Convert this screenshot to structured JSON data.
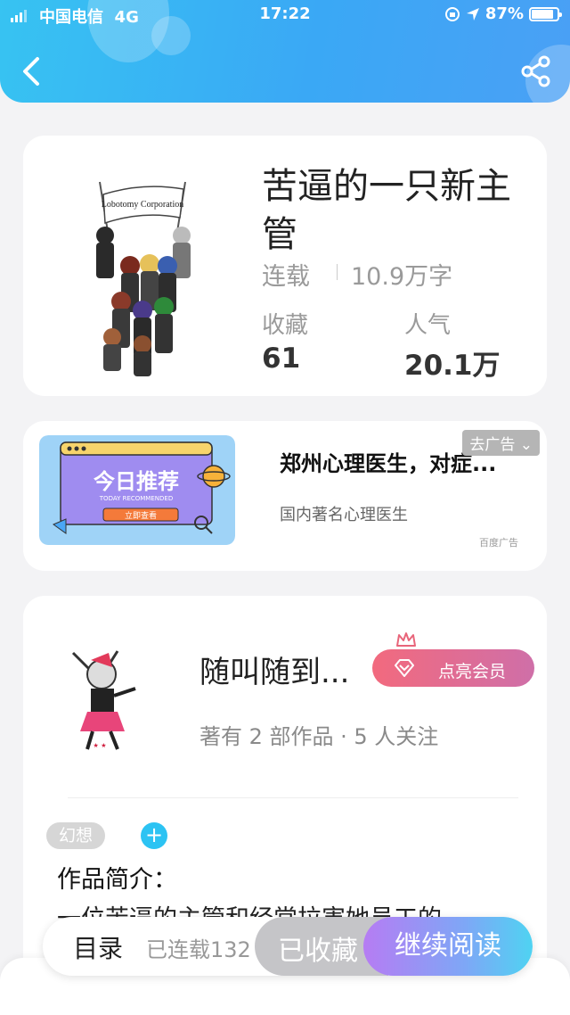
{
  "status_bar": {
    "carrier": "中国电信",
    "network": "4G",
    "time": "17:22",
    "battery": "87%",
    "battery_level": 0.87
  },
  "colors": {
    "header_start": "#37c3f2",
    "header_end": "#4aa0f5",
    "member_start": "#f26a7e",
    "member_end": "#cf6fa8",
    "accent": "#2cc3f3"
  },
  "header": {
    "back_icon": "chevron-left-icon",
    "share_icon": "share-icon"
  },
  "book": {
    "cover_text": "Lobotomy Corporation",
    "title": "苦逼的一只新主管",
    "status": "连载",
    "word_count": "10.9万字",
    "favorites_label": "收藏",
    "favorites": "61",
    "popularity_label": "人气",
    "popularity": "20.1万"
  },
  "ad": {
    "image_title": "今日推荐",
    "image_subtitle": "TODAY RECOMMENDED",
    "image_button": "立即查看",
    "title": "郑州心理医生，对症...",
    "remove_tag": "去广告",
    "subtitle": "国内著名心理医生",
    "brand": "百度广告"
  },
  "author": {
    "name": "随叫随到...",
    "member_button": "点亮会员",
    "meta": "著有 2 部作品 · 5 人关注",
    "genre_tag": "幻想",
    "intro_label": "作品简介：",
    "intro_text": "一位苦逼的主管和经常拉害她员工的"
  },
  "bottom": {
    "toc": "目录",
    "progress": "已连载132",
    "collected": "已收藏",
    "continue": "继续阅读"
  }
}
